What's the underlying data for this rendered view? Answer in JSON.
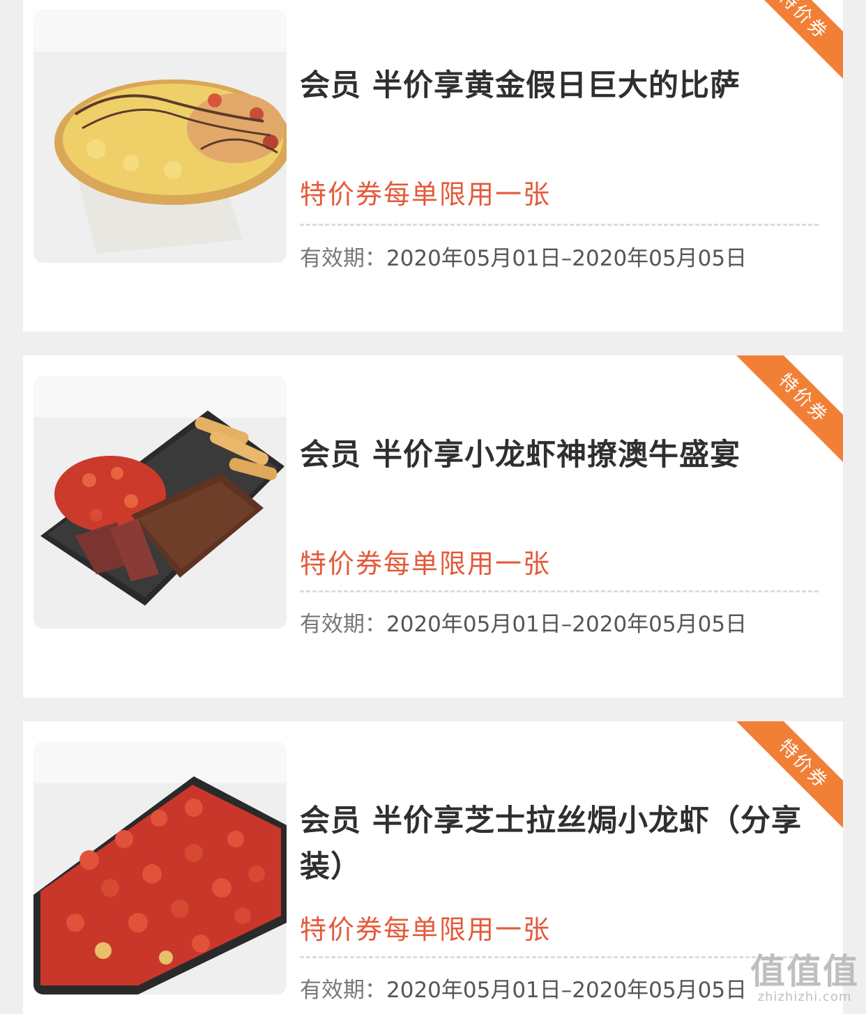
{
  "coupons": [
    {
      "title": "会员 半价享黄金假日巨大的比萨",
      "limit": "特价券每单限用一张",
      "validity_label": "有效期：",
      "validity_range": "2020年05月01日–2020年05月05日",
      "badge": "特价券",
      "image_icon": "pizza-photo"
    },
    {
      "title": "会员 半价享小龙虾神撩澳牛盛宴",
      "limit": "特价券每单限用一张",
      "validity_label": "有效期：",
      "validity_range": "2020年05月01日–2020年05月05日",
      "badge": "特价券",
      "image_icon": "steak-crayfish-platter-photo"
    },
    {
      "title": "会员 半价享芝士拉丝焗小龙虾（分享装）",
      "limit": "特价券每单限用一张",
      "validity_label": "有效期：",
      "validity_range": "2020年05月01日–2020年05月05日",
      "badge": "特价券",
      "image_icon": "baked-crayfish-photo"
    }
  ],
  "watermark": {
    "brand": "值值值",
    "domain": "zhizhizhi.com"
  },
  "colors": {
    "accent": "#e35a3a",
    "badge": "#f17f36",
    "background": "#efefef"
  }
}
